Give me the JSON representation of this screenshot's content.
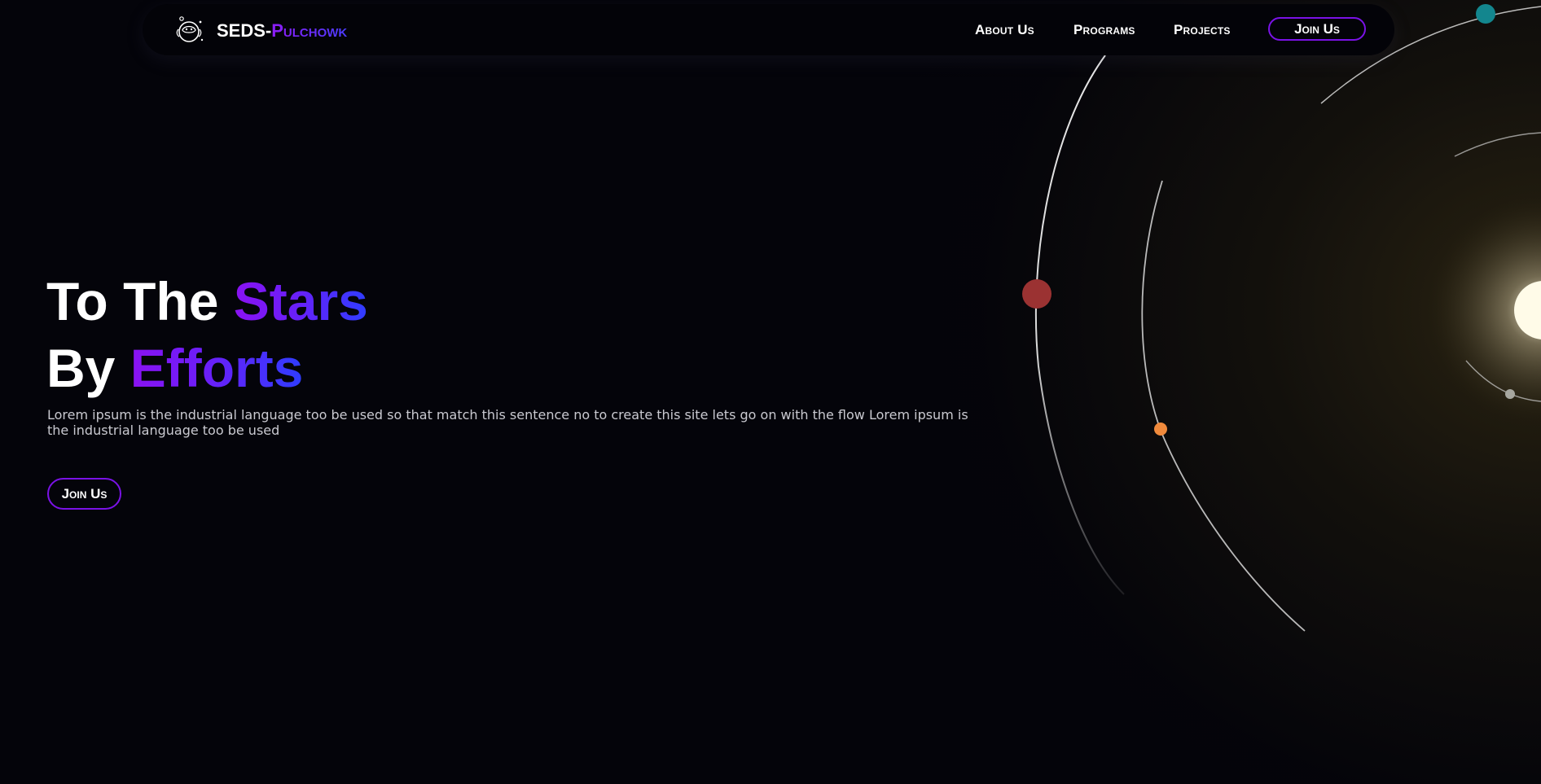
{
  "brand": {
    "prefix": "SEDS-",
    "suffix": "Pulchowk"
  },
  "nav": {
    "links": [
      "About Us",
      "Programs",
      "Projects"
    ],
    "cta": "Join Us"
  },
  "hero": {
    "line1_plain": "To The ",
    "line1_accent": "Stars",
    "line2_plain": "By ",
    "line2_accent": "Efforts",
    "description": "Lorem ipsum is the industrial language too be used so that match this sentence no to create this site lets go on with the flow Lorem ipsum is the industrial language too be used",
    "cta": "Join Us"
  },
  "colors": {
    "accent_purple": "#8a12f2",
    "accent_blue": "#2f3dff",
    "button_border": "#7a12e6",
    "planet_red": "#9b3232",
    "planet_orange": "#f08a3c",
    "planet_teal": "#13868e",
    "sun": "#fffbe8"
  },
  "icons": [
    "astronaut-logo-icon"
  ]
}
